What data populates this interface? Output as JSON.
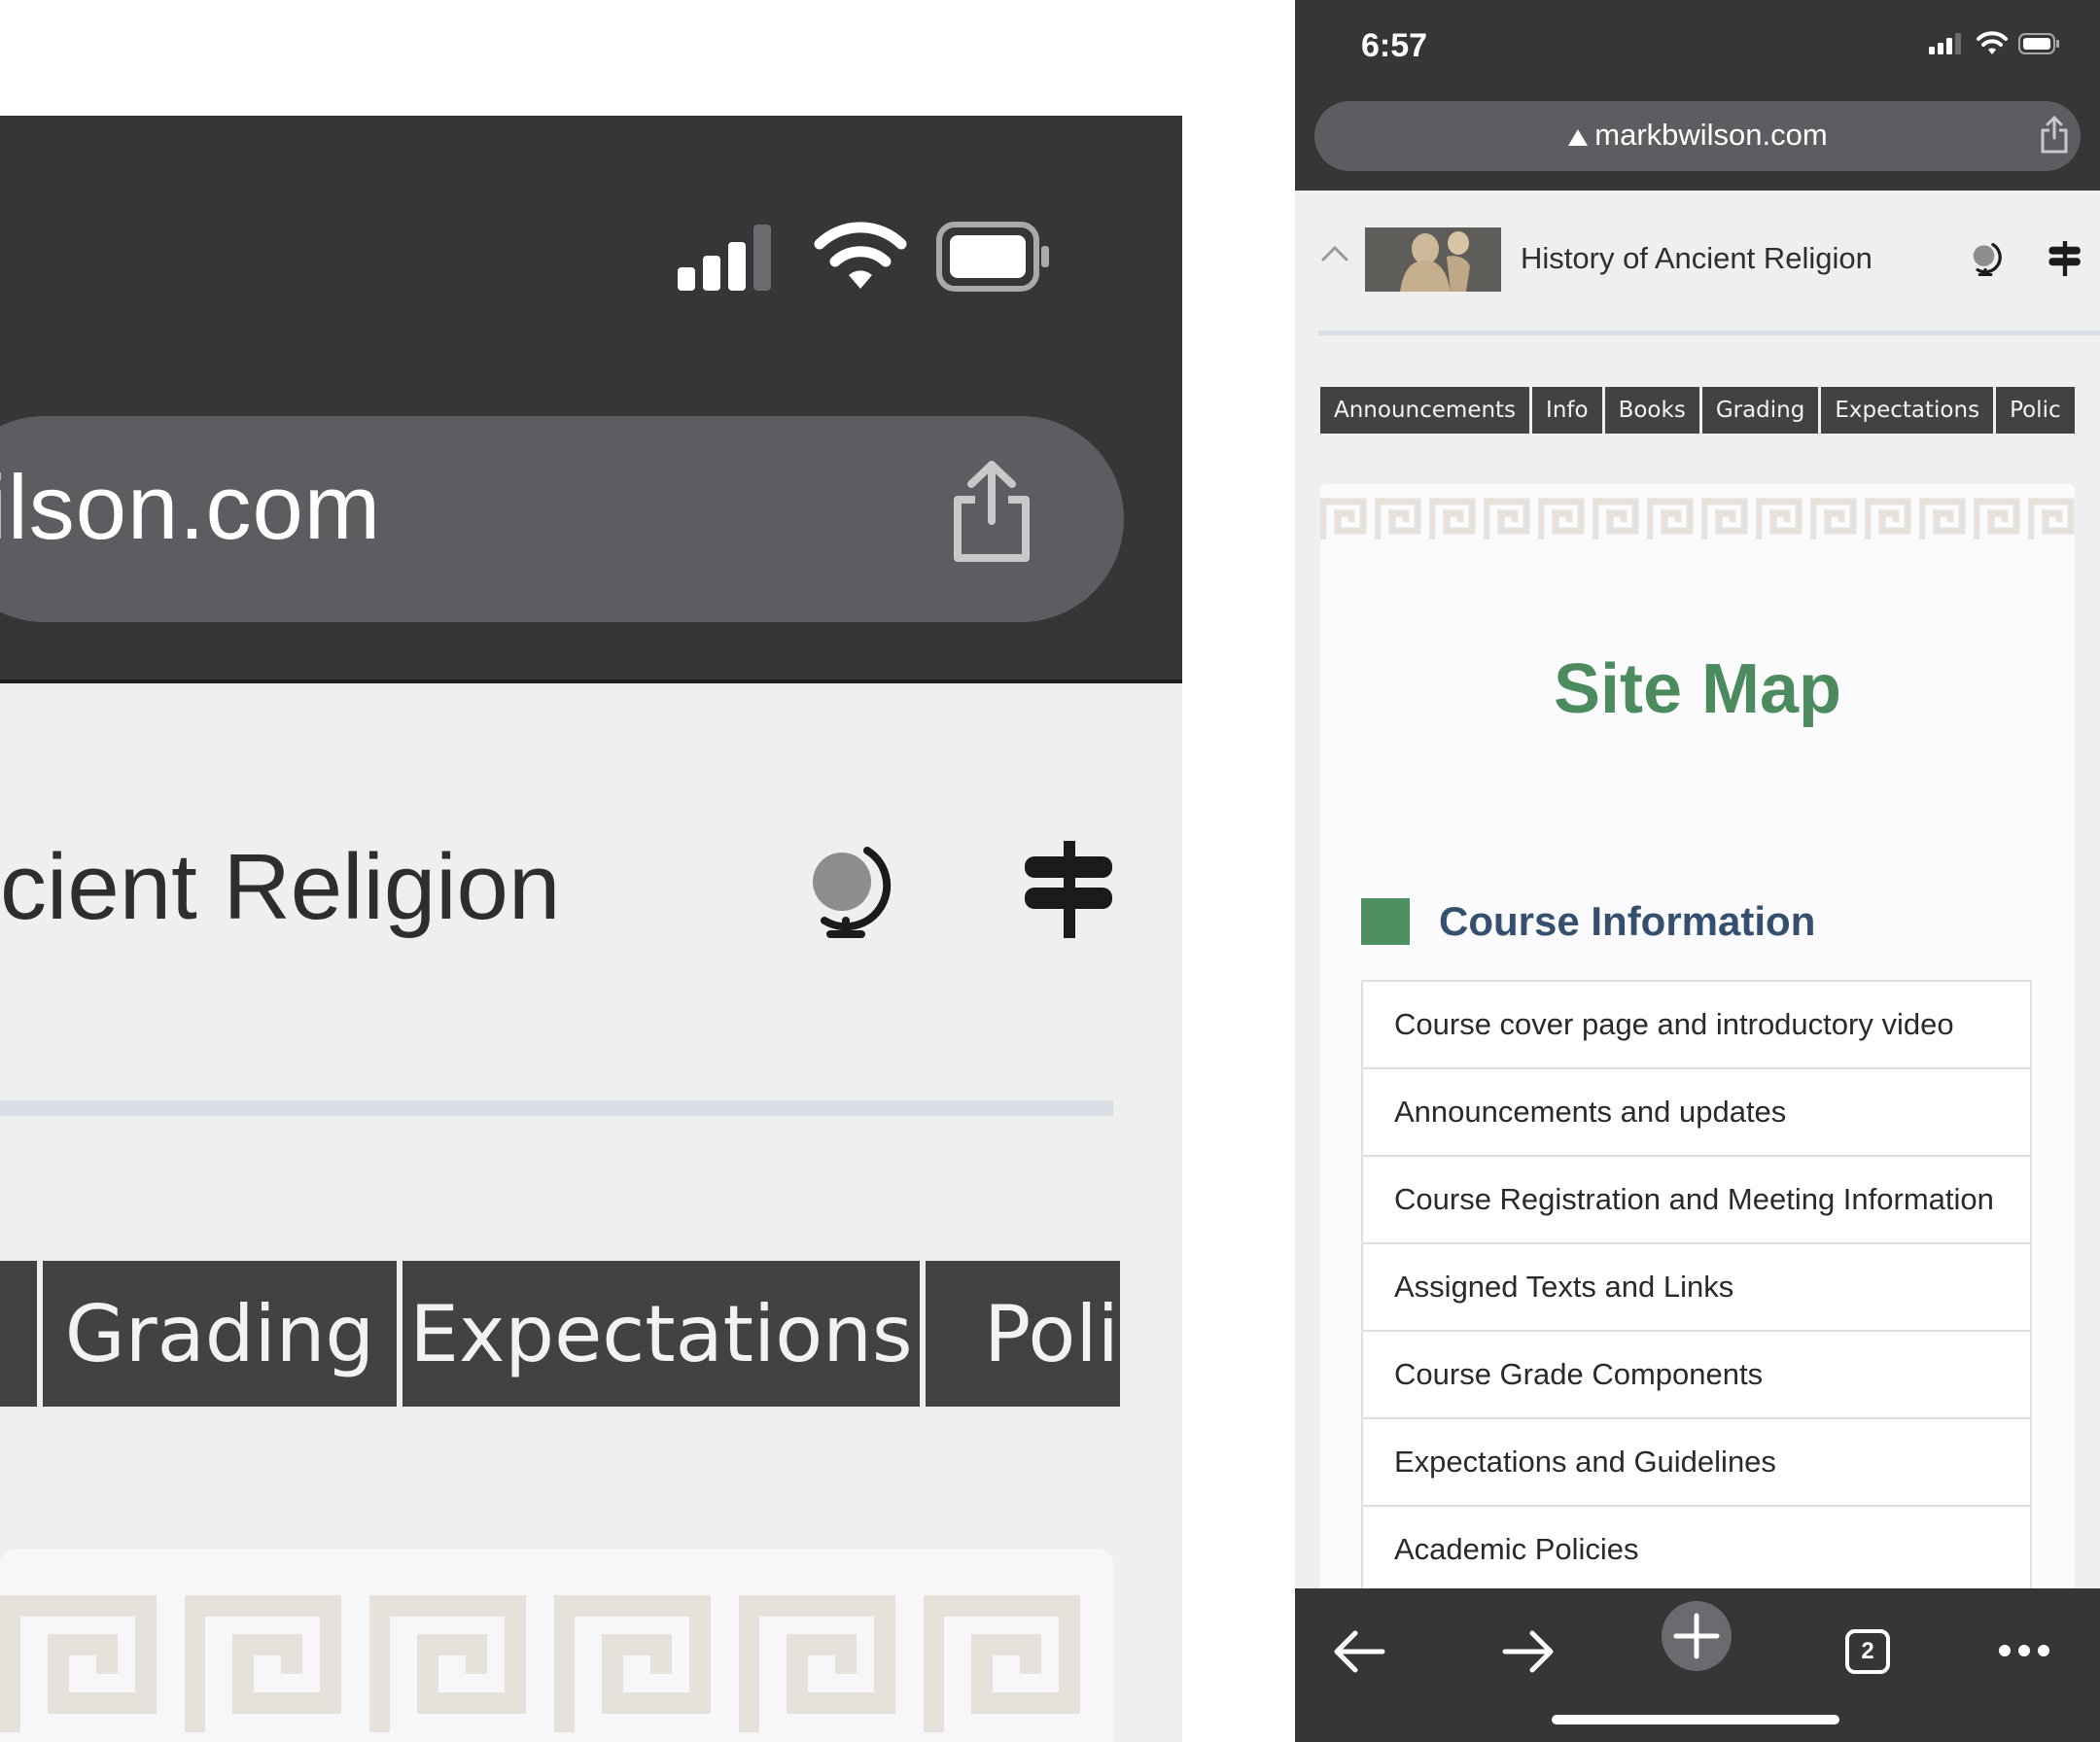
{
  "zoom": {
    "url_fragment": "ilson.com",
    "title_fragment": "cient Religion",
    "tabs": [
      "",
      "Grading",
      "Expectations",
      "Polic"
    ]
  },
  "phone": {
    "status": {
      "time": "6:57"
    },
    "url": "markbwilson.com",
    "site_title": "History of Ancient Religion",
    "tabs": [
      "Announcements",
      "Info",
      "Books",
      "Grading",
      "Expectations",
      "Polic"
    ],
    "page_title": "Site Map",
    "section_title": "Course Information",
    "items": [
      "Course cover page and introductory video",
      "Announcements and updates",
      "Course Registration and Meeting Information",
      "Assigned Texts and Links",
      "Course Grade Components",
      "Expectations and Guidelines",
      "Academic Policies"
    ],
    "tab_count": "2"
  },
  "colors": {
    "chrome": "#353638",
    "url_field": "#5c5d60",
    "tab_bg": "#414244",
    "accent_green": "#4b8b5e",
    "section_blue": "#34506e"
  },
  "icons": [
    "signal-icon",
    "wifi-icon",
    "battery-icon",
    "warning-icon",
    "share-icon",
    "globe-icon",
    "signpost-icon",
    "chevron-up-icon",
    "back-icon",
    "forward-icon",
    "new-tab-icon",
    "tabs-icon",
    "more-icon"
  ]
}
